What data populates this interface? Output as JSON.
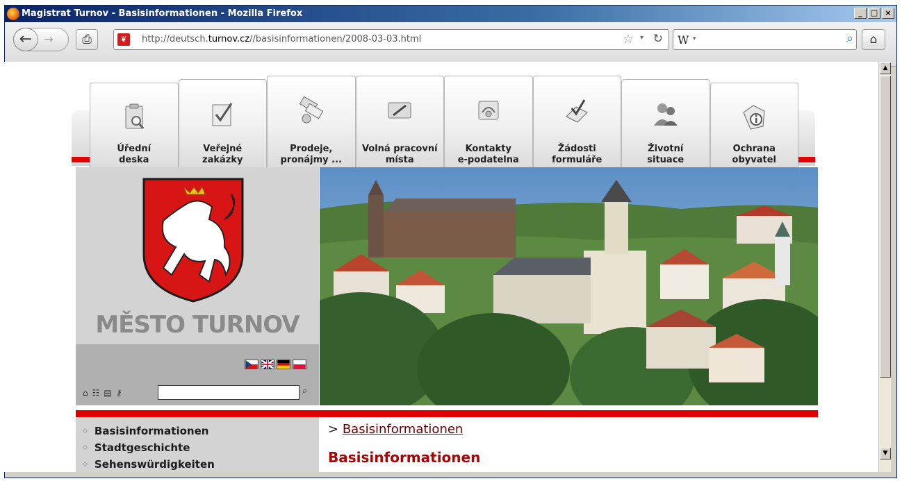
{
  "window": {
    "title": "Magistrat Turnov - Basisinformationen - Mozilla Firefox",
    "controls": [
      "_",
      "□",
      "×"
    ]
  },
  "toolbar": {
    "url_prefix": "http://deutsch.",
    "url_domain": "turnov.cz",
    "url_path": "//basisinformationen/2008-03-03.html",
    "search_engine": "W"
  },
  "tabs": [
    {
      "label_1": "Úřední",
      "label_2": "deska",
      "icon": "notice-board-icon"
    },
    {
      "label_1": "Veřejné",
      "label_2": "zakázky",
      "icon": "checklist-icon"
    },
    {
      "label_1": "Prodeje,",
      "label_2": "pronájmy ...",
      "icon": "documents-icon"
    },
    {
      "label_1": "Volná pracovní",
      "label_2": "místa",
      "icon": "pencil-icon"
    },
    {
      "label_1": "Kontakty",
      "label_2": "e-podatelna",
      "icon": "mail-icon"
    },
    {
      "label_1": "Žádosti",
      "label_2": "formuláře",
      "icon": "form-icon"
    },
    {
      "label_1": "Životní",
      "label_2": "situace",
      "icon": "people-icon"
    },
    {
      "label_1": "Ochrana",
      "label_2": "obyvatel",
      "icon": "shield-icon"
    }
  ],
  "branding": {
    "city_name": "MĚSTO TURNOV"
  },
  "languages": [
    "cs",
    "en",
    "de",
    "pl"
  ],
  "menu": {
    "items": [
      "Basisinformationen",
      "Stadtgeschichte",
      "Sehenswürdigkeiten"
    ]
  },
  "content": {
    "breadcrumb_prefix": ">",
    "breadcrumb_link": "Basisinformationen",
    "title": "Basisinformationen"
  },
  "colors": {
    "accent_red": "#e10000",
    "title_red": "#b10000",
    "sidebar_gray": "#d3d3d3"
  }
}
